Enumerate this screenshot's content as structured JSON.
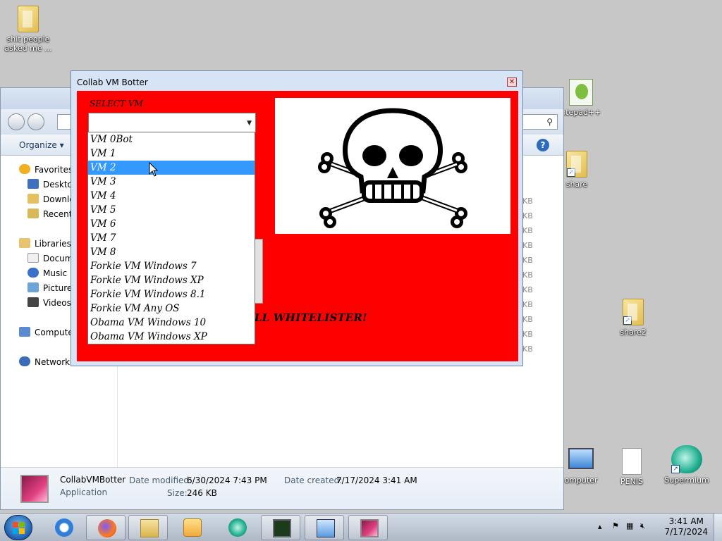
{
  "desktop": {
    "icons": [
      {
        "label": "shit people asked me ..."
      },
      {
        "label": "otepad++"
      },
      {
        "label": "share"
      },
      {
        "label": "share2"
      },
      {
        "label": "omputer"
      },
      {
        "label": "PENIS"
      },
      {
        "label": "Supermium"
      }
    ]
  },
  "explorer": {
    "organize_label": "Organize ▾",
    "search_glyph": "⚲",
    "help_glyph": "?",
    "nav": {
      "favorites": "Favorites",
      "desktop": "Desktop",
      "downloads": "Downlo",
      "recent": "Recent P",
      "libraries": "Libraries",
      "documents": "Docume",
      "music": "Music",
      "pictures": "Pictures",
      "videos": "Videos",
      "computer": "Compute",
      "network": "Network"
    },
    "size_units": [
      "KB",
      "KB",
      "KB",
      "KB",
      "KB",
      "KB",
      "KB",
      "KB",
      "KB",
      "KB",
      "KB"
    ],
    "details": {
      "name": "CollabVMBotter",
      "type": "Application",
      "modified_label": "Date modified:",
      "modified_value": "6/30/2024 7:43 PM",
      "size_label": "Size:",
      "size_value": "246 KB",
      "created_label": "Date created:",
      "created_value": "7/17/2024 3:41 AM"
    }
  },
  "dialog": {
    "title": "Collab VM Botter",
    "close_glyph": "✕",
    "select_label": "SELECT VM",
    "combo_value": "",
    "whitelister_text": "ALL WHITELISTER!",
    "dropdown": {
      "options": [
        "VM 0Bot",
        "VM 1",
        "VM 2",
        "VM 3",
        "VM 4",
        "VM 5",
        "VM 6",
        "VM 7",
        "VM 8",
        "Forkie VM Windows 7",
        "Forkie VM Windows XP",
        "Forkie VM Windows 8.1",
        "Forkie VM Any OS",
        "Obama VM Windows 10",
        "Obama VM Windows XP"
      ],
      "selected_index": 2
    },
    "colors": {
      "background": "#ff0000",
      "selection": "#3399ff"
    }
  },
  "taskbar": {
    "clock_time": "3:41 AM",
    "clock_date": "7/17/2024",
    "tray_icons": [
      "chevron-up-icon",
      "flag-icon",
      "network-icon",
      "volume-muted-icon"
    ]
  }
}
